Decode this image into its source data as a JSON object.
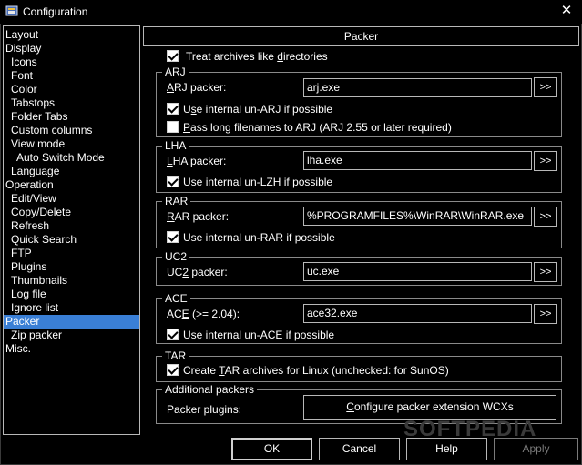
{
  "window": {
    "title": "Configuration",
    "close_label": "✕"
  },
  "tree": {
    "items": [
      "Layout",
      "Display",
      "Icons",
      "Font",
      "Color",
      "Tabstops",
      "Folder Tabs",
      "Custom columns",
      "View mode",
      "Auto Switch Mode",
      "Language",
      "Operation",
      "Edit/View",
      "Copy/Delete",
      "Refresh",
      "Quick Search",
      "FTP",
      "Plugins",
      "Thumbnails",
      "Log file",
      "Ignore list",
      "Packer",
      "Zip packer",
      "Misc."
    ],
    "selected": "Packer"
  },
  "page": {
    "header": "Packer",
    "treat_archives": {
      "pre": "Treat archives like ",
      "u": "d",
      "post": "irectories"
    }
  },
  "groups": {
    "arj": {
      "title": "ARJ",
      "packer_label": {
        "u": "A",
        "post": "RJ packer:"
      },
      "packer_value": "arj.exe",
      "opt1": {
        "pre": "U",
        "u": "s",
        "post": "e internal un-ARJ if possible"
      },
      "opt2": {
        "u": "P",
        "post": "ass long filenames to ARJ (ARJ 2.55 or later required)"
      }
    },
    "lha": {
      "title": "LHA",
      "packer_label": {
        "u": "L",
        "post": "HA packer:"
      },
      "packer_value": "lha.exe",
      "opt1": {
        "pre": "Use ",
        "u": "i",
        "post": "nternal un-LZH if possible"
      }
    },
    "rar": {
      "title": "RAR",
      "packer_label": {
        "u": "R",
        "post": "AR packer:"
      },
      "packer_value": "%PROGRAMFILES%\\WinRAR\\WinRAR.exe",
      "opt1": {
        "text": "Use internal un-RAR if possible"
      }
    },
    "uc2": {
      "title": "UC2",
      "packer_label": {
        "pre": "UC",
        "u": "2",
        "post": " packer:"
      },
      "packer_value": "uc.exe"
    },
    "ace": {
      "title": "ACE",
      "packer_label": {
        "pre": "AC",
        "u": "E",
        "post": " (>= 2.04):"
      },
      "packer_value": "ace32.exe",
      "opt1": {
        "text": "Use internal un-ACE if possible"
      }
    },
    "tar": {
      "title": "TAR",
      "opt1": {
        "pre": "Create ",
        "u": "T",
        "post": "AR archives for Linux (unchecked: for SunOS)"
      }
    },
    "additional": {
      "title": "Additional packers",
      "plugins_label": "Packer plugins:",
      "plugins_button": {
        "u": "C",
        "post": "onfigure packer extension WCXs"
      }
    }
  },
  "browse_label": ">>",
  "buttons": {
    "ok": "OK",
    "cancel": "Cancel",
    "help": "Help",
    "apply": "Apply"
  },
  "watermark": "SOFTPEDIA"
}
